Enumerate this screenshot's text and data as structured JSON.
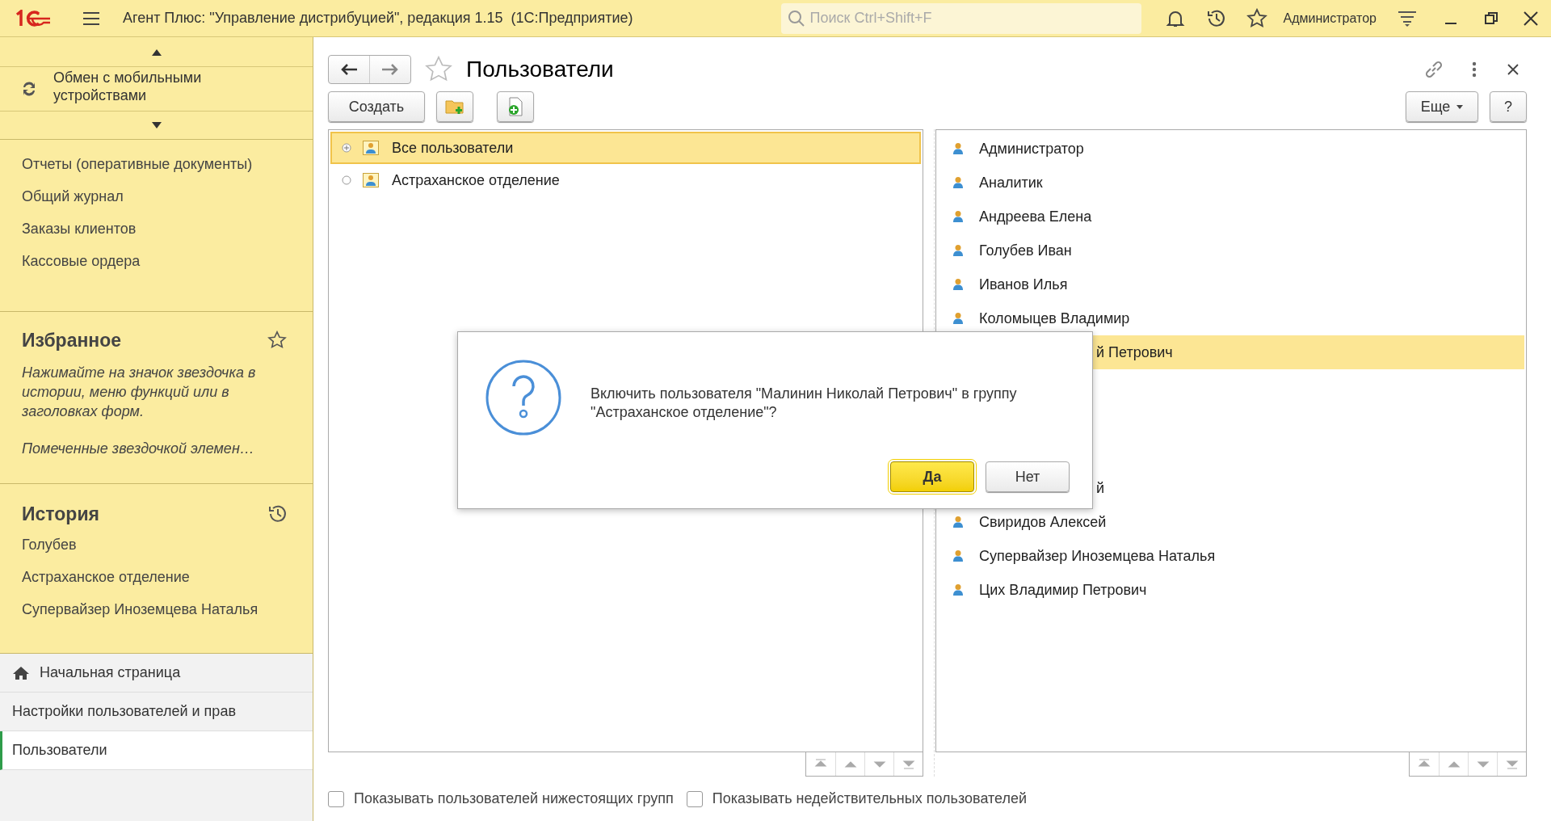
{
  "window": {
    "title": "Агент Плюс: \"Управление дистрибуцией\", редакция 1.15  (1С:Предприятие)",
    "search_placeholder": "Поиск Ctrl+Shift+F",
    "user": "Администратор"
  },
  "sidebar": {
    "section_item": "Обмен с мобильными устройствами",
    "items": [
      "Отчеты (оперативные документы)",
      "Общий журнал",
      "Заказы клиентов",
      "Кассовые ордера"
    ],
    "favorites": {
      "title": "Избранное",
      "hint": "Нажимайте на значок звездочка в истории, меню функций или в заголовках форм.",
      "hint2": "Помеченные звездочкой элемен…"
    },
    "history": {
      "title": "История",
      "items": [
        "Голубев",
        "Астраханское отделение",
        "Супервайзер Иноземцева Наталья"
      ]
    },
    "open_windows": [
      {
        "label": "Начальная страница",
        "kind": "home",
        "selected": false
      },
      {
        "label": "Настройки пользователей и прав",
        "kind": "page",
        "selected": false
      },
      {
        "label": "Пользователи",
        "kind": "page",
        "selected": true
      }
    ]
  },
  "form": {
    "title": "Пользователи",
    "create_button": "Создать",
    "more_button": "Еще",
    "help_button": "?",
    "groups": [
      {
        "name": "Все пользователи",
        "expanded": false,
        "selected": true
      },
      {
        "name": "Астраханское отделение",
        "selected": false
      }
    ],
    "users": [
      {
        "name": "Администратор",
        "kind": "full",
        "selected": false
      },
      {
        "name": "Аналитик",
        "kind": "full",
        "selected": false
      },
      {
        "name": "Андреева Елена",
        "kind": "full",
        "selected": false
      },
      {
        "name": "Голубев Иван",
        "kind": "full",
        "selected": false
      },
      {
        "name": "Иванов Илья",
        "kind": "full",
        "selected": false
      },
      {
        "name": "Коломыцев Владимир",
        "kind": "full",
        "selected": false
      },
      {
        "name": "й Петрович",
        "kind": "covered",
        "selected": true
      },
      {
        "kind": "hidden"
      },
      {
        "kind": "hidden"
      },
      {
        "kind": "hidden"
      },
      {
        "name": "й",
        "kind": "covered",
        "selected": false
      },
      {
        "name": "Свиридов Алексей",
        "kind": "full",
        "selected": false
      },
      {
        "name": "Супервайзер Иноземцева Наталья",
        "kind": "full",
        "selected": false
      },
      {
        "name": "Цих Владимир Петрович",
        "kind": "full",
        "selected": false
      }
    ],
    "options": [
      {
        "label": "Показывать пользователей нижестоящих групп",
        "checked": false
      },
      {
        "label": "Показывать недействительных пользователей",
        "checked": false
      }
    ]
  },
  "dialog": {
    "message": "Включить пользователя \"Малинин Николай Петрович\" в группу \"Астраханское отделение\"?",
    "buttons": [
      {
        "label": "Да",
        "default": true
      },
      {
        "label": "Нет",
        "default": false
      }
    ]
  }
}
